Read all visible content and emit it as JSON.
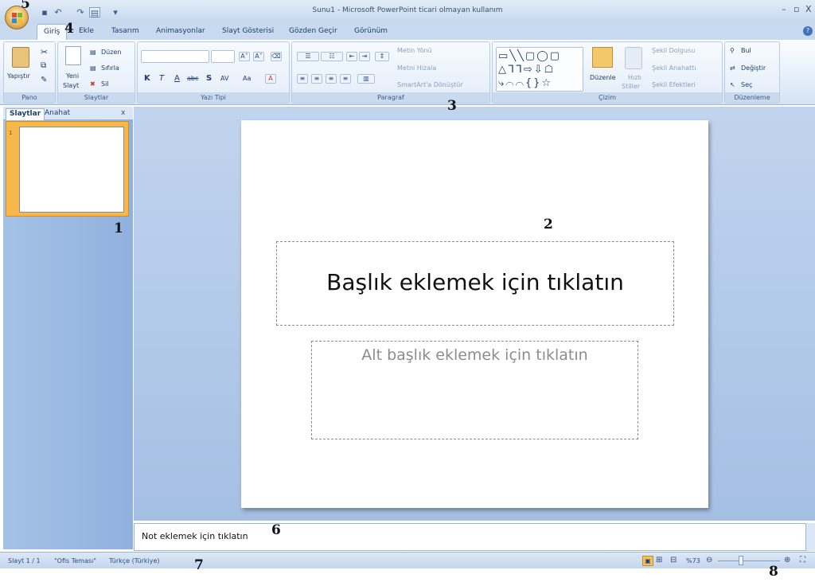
{
  "window": {
    "title": "Sunu1 - Microsoft PowerPoint ticari olmayan kullanım",
    "controls": {
      "minimize": "–",
      "restore": "▫",
      "close": "X"
    }
  },
  "quick_access": {
    "save_icon": "save-icon",
    "undo_icon": "undo-icon",
    "redo_icon": "redo-icon",
    "more": "▾"
  },
  "tabs": [
    "Giriş",
    "Ekle",
    "Tasarım",
    "Animasyonlar",
    "Slayt Gösterisi",
    "Gözden Geçir",
    "Görünüm"
  ],
  "ribbon": {
    "pano": {
      "label": "Pano",
      "paste": "Yapıştır"
    },
    "slaytlar": {
      "label": "Slaytlar",
      "new_slide_1": "Yeni",
      "new_slide_2": "Slayt",
      "layout": "Düzen",
      "reset": "Sıfırla",
      "delete": "Sil"
    },
    "yazi_tipi": {
      "label": "Yazı Tipi",
      "grow": "A˄",
      "shrink": "A˅",
      "bold": "K",
      "italic": "T",
      "underline": "A",
      "strike": "abc",
      "shadow": "S",
      "spacing": "AV",
      "case": "Aa",
      "color": "A"
    },
    "paragraf": {
      "label": "Paragraf",
      "text_direction": "Metin Yönü",
      "align_text": "Metni Hizala",
      "smartart": "SmartArt'a Dönüştür"
    },
    "cizim": {
      "label": "Çizim",
      "arrange": "Düzenle",
      "quick_styles_1": "Hızlı",
      "quick_styles_2": "Stiller",
      "shape_fill": "Şekil Dolgusu",
      "shape_outline": "Şekil Anahattı",
      "shape_effects": "Şekil Efektleri"
    },
    "duzenleme": {
      "label": "Düzenleme",
      "find": "Bul",
      "replace": "Değiştir",
      "select": "Seç"
    }
  },
  "left_pane": {
    "tab_slides": "Slaytlar",
    "tab_outline": "Anahat",
    "close": "x",
    "slide_number": "1"
  },
  "slide": {
    "title_placeholder": "Başlık eklemek için tıklatın",
    "subtitle_placeholder": "Alt başlık eklemek için tıklatın"
  },
  "notes": {
    "placeholder": "Not eklemek için tıklatın"
  },
  "status": {
    "slide_info": "Slayt 1 / 1",
    "theme": "\"Ofis Teması\"",
    "language": "Türkçe (Türkiye)",
    "zoom": "%73"
  },
  "annotations": [
    "1",
    "2",
    "3",
    "4",
    "5",
    "6",
    "7",
    "8"
  ],
  "colors": {
    "ribbon": "#dbe7f6",
    "accent_orange": "#f6b84a",
    "text_blue": "#15428b"
  }
}
